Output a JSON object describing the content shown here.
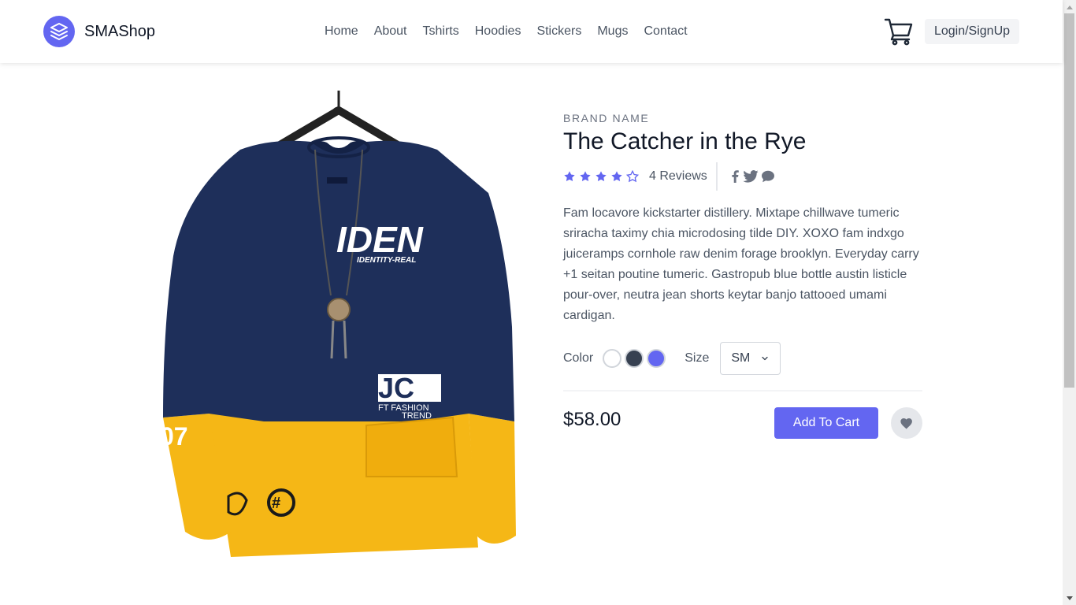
{
  "header": {
    "brand": "SMAShop",
    "nav": [
      "Home",
      "About",
      "Tshirts",
      "Hoodies",
      "Stickers",
      "Mugs",
      "Contact"
    ],
    "login_label": "Login/SignUp",
    "icons": {
      "logo": "layers-icon",
      "cart": "cart-icon"
    }
  },
  "product": {
    "brand": "BRAND NAME",
    "title": "The Catcher in the Rye",
    "rating": 4,
    "rating_max": 5,
    "reviews": "4 Reviews",
    "description": "Fam locavore kickstarter distillery. Mixtape chillwave tumeric sriracha taximy chia microdosing tilde DIY. XOXO fam indxgo juiceramps cornhole raw denim forage brooklyn. Everyday carry +1 seitan poutine tumeric. Gastropub blue bottle austin listicle pour-over, neutra jean shorts keytar banjo tattooed umami cardigan.",
    "color_label": "Color",
    "colors": [
      "#ffffff",
      "#374151",
      "#6366f1"
    ],
    "size_label": "Size",
    "size_value": "SM",
    "price": "$58.00",
    "add_to_cart_label": "Add To Cart",
    "image_text": {
      "main": "IDEN",
      "sub": "IDENTITY-REAL",
      "badge": "JC",
      "badge_sub1": "FT FASHION",
      "badge_sub2": "TREND",
      "sleeve": "07"
    }
  },
  "colors": {
    "accent": "#6366f1",
    "hoodie_navy": "#1e2f5a",
    "hoodie_yellow": "#f5b716"
  }
}
